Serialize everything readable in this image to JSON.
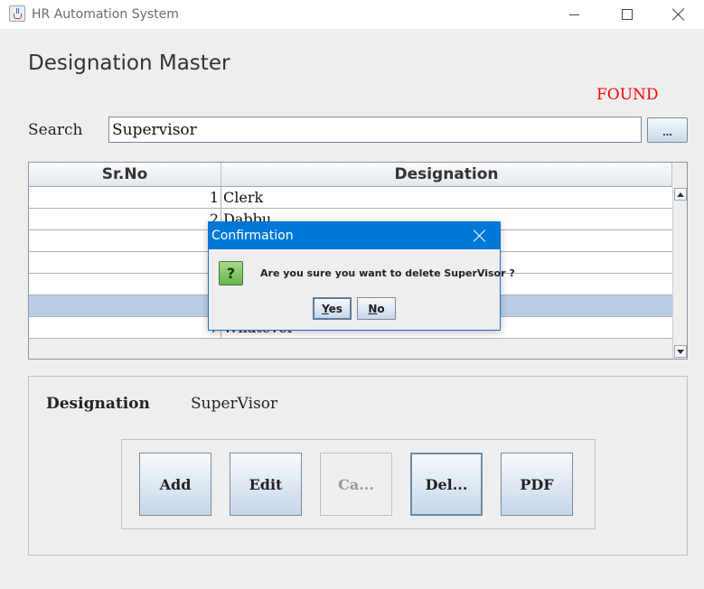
{
  "window": {
    "title": "HR Automation System"
  },
  "page": {
    "heading": "Designation Master",
    "status": "FOUND",
    "status_color": "#ff0000"
  },
  "search": {
    "label": "Search",
    "value": "Supervisor",
    "browse_label": "..."
  },
  "table": {
    "columns": [
      "Sr.No",
      "Designation"
    ],
    "rows": [
      {
        "sr": "1",
        "name": "Clerk"
      },
      {
        "sr": "2",
        "name": "Dabbu"
      },
      {
        "sr": "",
        "name": ""
      },
      {
        "sr": "",
        "name": ""
      },
      {
        "sr": "",
        "name": ""
      },
      {
        "sr": "",
        "name": ""
      },
      {
        "sr": "7",
        "name": "Whatever"
      }
    ]
  },
  "detail": {
    "label": "Designation",
    "value": "SuperVisor"
  },
  "actions": {
    "add": "Add",
    "edit": "Edit",
    "cancel": "Ca...",
    "delete": "Del...",
    "pdf": "PDF"
  },
  "dialog": {
    "title": "Confirmation",
    "icon": "question-icon",
    "icon_glyph": "?",
    "message": "Are you sure you want to delete SuperVisor ?",
    "yes_mnemonic": "Y",
    "yes_rest": "es",
    "no_mnemonic": "N",
    "no_rest": "o"
  },
  "colors": {
    "dialog_titlebar": "#0078d7",
    "selected_row": "#b8cfe5"
  }
}
